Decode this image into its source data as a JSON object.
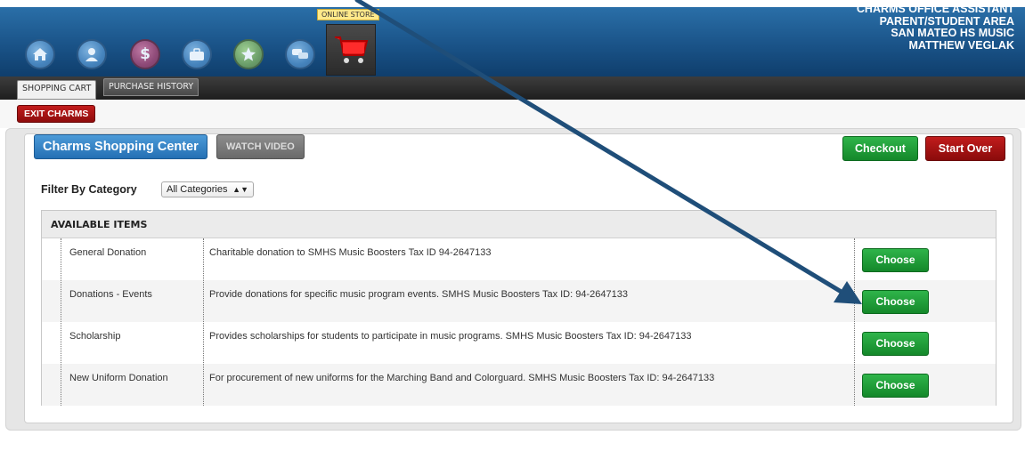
{
  "header": {
    "store_tooltip": "ONLINE STORE",
    "info_lines": [
      "CHARMS OFFICE ASSISTANT",
      "PARENT/STUDENT AREA",
      "SAN MATEO HS MUSIC",
      "MATTHEW VEGLAK"
    ],
    "nav_icons": [
      "home-icon",
      "person-icon",
      "dollar-icon",
      "briefcase-icon",
      "star-icon",
      "chat-icon"
    ],
    "finance_glyph": "$"
  },
  "tabs": {
    "active": "SHOPPING CART",
    "inactive": "PURCHASE HISTORY"
  },
  "exit_label": "EXIT CHARMS",
  "main": {
    "title": "Charms Shopping Center",
    "video_label": "WATCH VIDEO",
    "checkout_label": "Checkout",
    "startover_label": "Start Over",
    "filter_label": "Filter By Category",
    "filter_value": "All Categories",
    "table_header": "AVAILABLE ITEMS",
    "choose_label": "Choose",
    "items": [
      {
        "name": "General Donation",
        "desc": "Charitable donation to SMHS Music Boosters Tax ID 94-2647133"
      },
      {
        "name": "Donations - Events",
        "desc": "Provide donations for specific music program events. SMHS Music Boosters Tax ID: 94-2647133"
      },
      {
        "name": "Scholarship",
        "desc": "Provides scholarships for students to participate in music programs. SMHS Music Boosters Tax ID: 94-2647133"
      },
      {
        "name": "New Uniform Donation",
        "desc": "For procurement of new uniforms for the Marching Band and Colorguard. SMHS Music Boosters Tax ID: 94-2647133"
      }
    ]
  },
  "colors": {
    "accent_blue": "#2470b4",
    "green": "#14882a",
    "red": "#8e0c0c",
    "arrow": "#1f4e79"
  }
}
